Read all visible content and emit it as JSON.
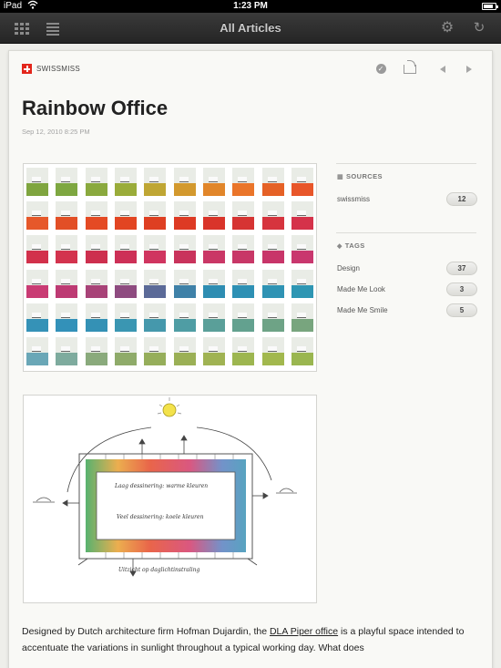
{
  "status_bar": {
    "carrier": "iPad",
    "time": "1:23 PM",
    "battery_level": 0.8
  },
  "navbar": {
    "title": "All Articles",
    "icons": [
      "grid-icon",
      "list-icon",
      "gear-icon",
      "refresh-icon"
    ]
  },
  "article": {
    "source": "SWISSMISS",
    "title": "Rainbow Office",
    "date": "Sep 12, 2010 8:25 PM",
    "toolbar_icons": [
      "check-icon",
      "share-icon",
      "prev-icon",
      "next-icon"
    ],
    "body": {
      "intro": "Designed by Dutch architecture firm Hofman Dujardin, the ",
      "link": "DLA Piper office",
      "rest": " is a playful space intended to accentuate the variations in sunlight throughout a typical working day. What does"
    },
    "photo_grid": {
      "row_colors": [
        [
          "#7fa53f",
          "#7ea741",
          "#8aa93e",
          "#9aac3a",
          "#bfa634",
          "#d3992e",
          "#e1862a",
          "#ea752a",
          "#e56126",
          "#e8562a"
        ],
        [
          "#e6582a",
          "#e24f26",
          "#e44a24",
          "#e24522",
          "#de3f22",
          "#dd3a24",
          "#d9342a",
          "#d63433",
          "#d6343e",
          "#d5324a"
        ],
        [
          "#d2314b",
          "#d3334e",
          "#cd2f4e",
          "#cd3057",
          "#d03560",
          "#c9335c",
          "#ca3766",
          "#c83767",
          "#c83569",
          "#c9376e"
        ],
        [
          "#c93b73",
          "#bd3a73",
          "#a84378",
          "#8e4b80",
          "#5b6a98",
          "#3f81a8",
          "#2e8db2",
          "#2e90b4",
          "#2f93b4",
          "#2e96b3"
        ],
        [
          "#3592b7",
          "#3391b9",
          "#3491b5",
          "#3a96b2",
          "#4598ac",
          "#4f9da4",
          "#5a9f99",
          "#63a18f",
          "#6ea386",
          "#78a57e"
        ],
        [
          "#6aa7b7",
          "#7eab9e",
          "#8aaa7c",
          "#8fab6a",
          "#96ae5b",
          "#9bb056",
          "#a0b353",
          "#9db650",
          "#a2b84e",
          "#9ab650"
        ]
      ]
    },
    "sketch": {
      "text_lines": [
        "Laag dessinering: warme kleuren",
        "Veel dessinering: koele kleuren",
        "Uitzicht op daglichtinstraling"
      ]
    }
  },
  "sidebar": {
    "sources": {
      "heading": "SOURCES",
      "items": [
        {
          "label": "swissmiss",
          "count": "12"
        }
      ]
    },
    "tags": {
      "heading": "TAGS",
      "items": [
        {
          "label": "Design",
          "count": "37"
        },
        {
          "label": "Made Me Look",
          "count": "3"
        },
        {
          "label": "Made Me Smile",
          "count": "5"
        }
      ]
    }
  }
}
